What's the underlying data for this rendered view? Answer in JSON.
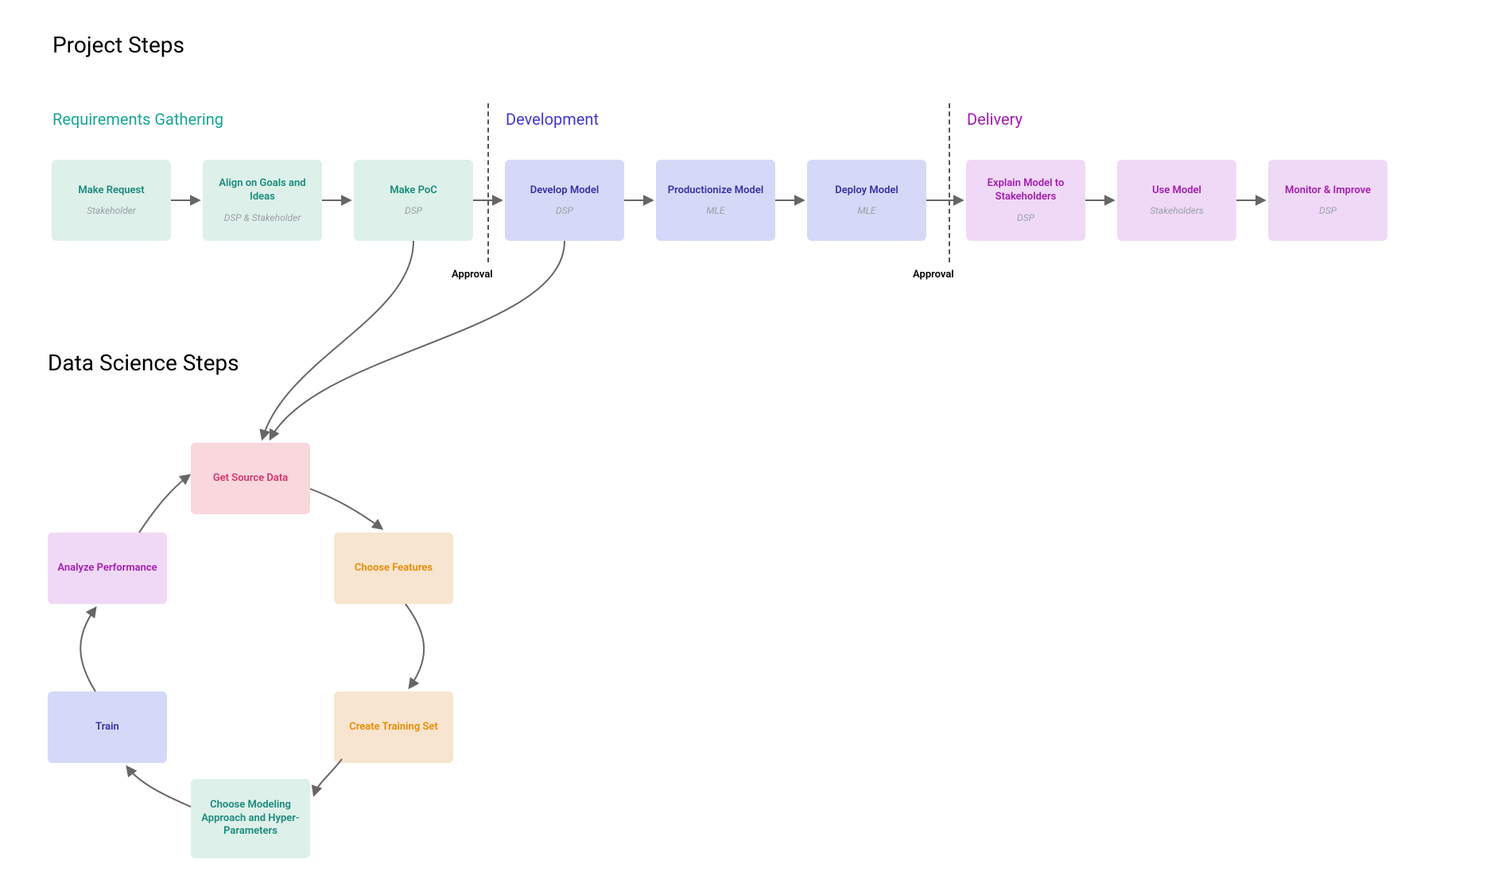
{
  "headings": {
    "project_steps": "Project Steps",
    "data_science_steps": "Data Science Steps"
  },
  "phases": {
    "requirements": "Requirements Gathering",
    "development": "Development",
    "delivery": "Delivery"
  },
  "approval": "Approval",
  "project_nodes": {
    "make_request": {
      "title": "Make Request",
      "sub": "Stakeholder"
    },
    "align_goals": {
      "title": "Align on Goals and Ideas",
      "sub": "DSP & Stakeholder"
    },
    "make_poc": {
      "title": "Make PoC",
      "sub": "DSP"
    },
    "develop_model": {
      "title": "Develop Model",
      "sub": "DSP"
    },
    "productionize": {
      "title": "Productionize Model",
      "sub": "MLE"
    },
    "deploy": {
      "title": "Deploy Model",
      "sub": "MLE"
    },
    "explain": {
      "title": "Explain Model to Stakeholders",
      "sub": "DSP"
    },
    "use_model": {
      "title": "Use Model",
      "sub": "Stakeholders"
    },
    "monitor": {
      "title": "Monitor & Improve",
      "sub": "DSP"
    }
  },
  "ds_nodes": {
    "source": {
      "title": "Get Source Data"
    },
    "features": {
      "title": "Choose Features"
    },
    "training_set": {
      "title": "Create Training Set"
    },
    "modeling": {
      "title": "Choose Modeling Approach and Hyper-Parameters"
    },
    "train": {
      "title": "Train"
    },
    "analyze": {
      "title": "Analyze Performance"
    }
  },
  "colors": {
    "teal": "#def0ea",
    "indigo": "#d5d9f7",
    "purple": "#f0d9f7",
    "pink": "#f8d7dd",
    "orange": "#f8e5cf"
  }
}
